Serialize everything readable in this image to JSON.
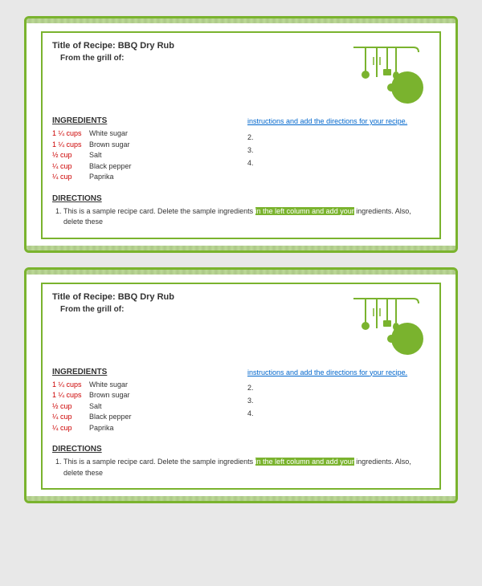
{
  "cards": [
    {
      "id": "card-1",
      "title": "Title of Recipe: BBQ Dry Rub",
      "from_grill_label": "From the grill of:",
      "ingredients_heading": "INGREDIENTS",
      "ingredients": [
        {
          "amount": "1 ¼ cups",
          "name": "White sugar"
        },
        {
          "amount": "1 ¼ cups",
          "name": "Brown sugar"
        },
        {
          "amount": "½ cup",
          "name": "Salt"
        },
        {
          "amount": "¼ cup",
          "name": "Black pepper"
        },
        {
          "amount": "¼ cup",
          "name": "Paprika"
        }
      ],
      "instructions_intro": "instructions and add the directions for your recipe.",
      "numbered_items": [
        "2.",
        "3.",
        "4."
      ],
      "directions_heading": "DIRECTIONS",
      "directions": [
        {
          "num": "1.",
          "text_normal": "This is a sample recipe card. Delete the sample ingredients in the left column and add your ingredients. Also, delete these",
          "text_highlight": "in the left column and add your"
        }
      ]
    },
    {
      "id": "card-2",
      "title": "Title of Recipe: BBQ Dry Rub",
      "from_grill_label": "From the grill of:",
      "ingredients_heading": "INGREDIENTS",
      "ingredients": [
        {
          "amount": "1 ¼ cups",
          "name": "White sugar"
        },
        {
          "amount": "1 ¼ cups",
          "name": "Brown sugar"
        },
        {
          "amount": "½ cup",
          "name": "Salt"
        },
        {
          "amount": "¼ cup",
          "name": "Black pepper"
        },
        {
          "amount": "¼ cup",
          "name": "Paprika"
        }
      ],
      "instructions_intro": "instructions and add the directions for your recipe.",
      "numbered_items": [
        "2.",
        "3.",
        "4."
      ],
      "directions_heading": "DIRECTIONS",
      "directions": [
        {
          "num": "1.",
          "text_normal": "This is a sample recipe card. Delete the sample ingredients in the left column and add your ingredients. Also, delete these",
          "text_highlight": "in the left column and add your"
        }
      ]
    }
  ],
  "colors": {
    "green": "#7ab32e",
    "red": "#cc0000",
    "link": "#0066cc"
  }
}
